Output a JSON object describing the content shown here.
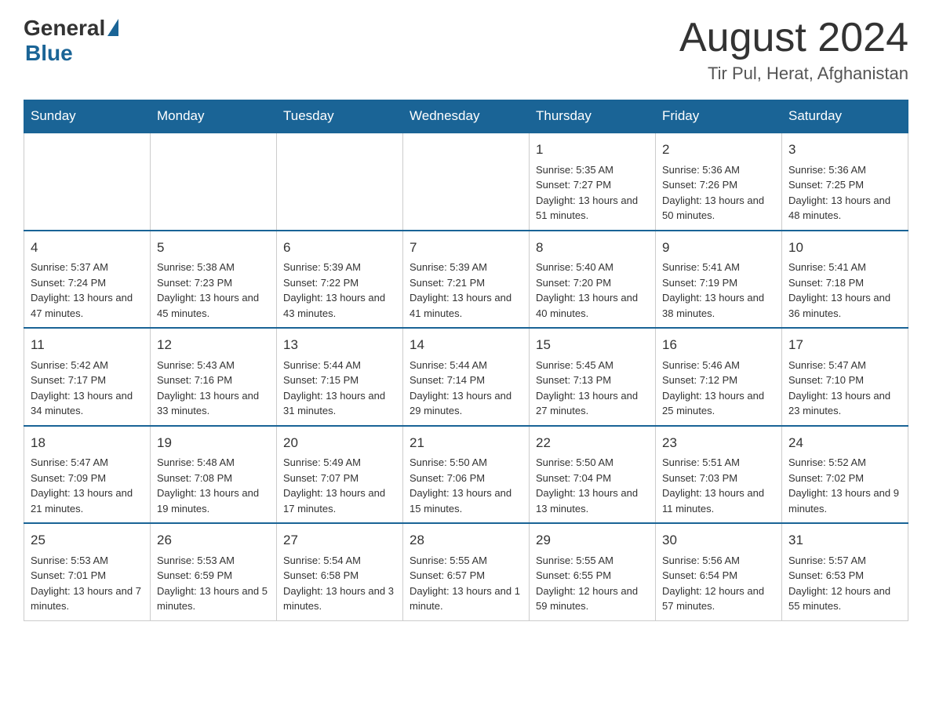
{
  "logo": {
    "general": "General",
    "blue": "Blue"
  },
  "title": {
    "month_year": "August 2024",
    "location": "Tir Pul, Herat, Afghanistan"
  },
  "days_of_week": [
    "Sunday",
    "Monday",
    "Tuesday",
    "Wednesday",
    "Thursday",
    "Friday",
    "Saturday"
  ],
  "weeks": [
    [
      {
        "day": "",
        "info": ""
      },
      {
        "day": "",
        "info": ""
      },
      {
        "day": "",
        "info": ""
      },
      {
        "day": "",
        "info": ""
      },
      {
        "day": "1",
        "info": "Sunrise: 5:35 AM\nSunset: 7:27 PM\nDaylight: 13 hours and 51 minutes."
      },
      {
        "day": "2",
        "info": "Sunrise: 5:36 AM\nSunset: 7:26 PM\nDaylight: 13 hours and 50 minutes."
      },
      {
        "day": "3",
        "info": "Sunrise: 5:36 AM\nSunset: 7:25 PM\nDaylight: 13 hours and 48 minutes."
      }
    ],
    [
      {
        "day": "4",
        "info": "Sunrise: 5:37 AM\nSunset: 7:24 PM\nDaylight: 13 hours and 47 minutes."
      },
      {
        "day": "5",
        "info": "Sunrise: 5:38 AM\nSunset: 7:23 PM\nDaylight: 13 hours and 45 minutes."
      },
      {
        "day": "6",
        "info": "Sunrise: 5:39 AM\nSunset: 7:22 PM\nDaylight: 13 hours and 43 minutes."
      },
      {
        "day": "7",
        "info": "Sunrise: 5:39 AM\nSunset: 7:21 PM\nDaylight: 13 hours and 41 minutes."
      },
      {
        "day": "8",
        "info": "Sunrise: 5:40 AM\nSunset: 7:20 PM\nDaylight: 13 hours and 40 minutes."
      },
      {
        "day": "9",
        "info": "Sunrise: 5:41 AM\nSunset: 7:19 PM\nDaylight: 13 hours and 38 minutes."
      },
      {
        "day": "10",
        "info": "Sunrise: 5:41 AM\nSunset: 7:18 PM\nDaylight: 13 hours and 36 minutes."
      }
    ],
    [
      {
        "day": "11",
        "info": "Sunrise: 5:42 AM\nSunset: 7:17 PM\nDaylight: 13 hours and 34 minutes."
      },
      {
        "day": "12",
        "info": "Sunrise: 5:43 AM\nSunset: 7:16 PM\nDaylight: 13 hours and 33 minutes."
      },
      {
        "day": "13",
        "info": "Sunrise: 5:44 AM\nSunset: 7:15 PM\nDaylight: 13 hours and 31 minutes."
      },
      {
        "day": "14",
        "info": "Sunrise: 5:44 AM\nSunset: 7:14 PM\nDaylight: 13 hours and 29 minutes."
      },
      {
        "day": "15",
        "info": "Sunrise: 5:45 AM\nSunset: 7:13 PM\nDaylight: 13 hours and 27 minutes."
      },
      {
        "day": "16",
        "info": "Sunrise: 5:46 AM\nSunset: 7:12 PM\nDaylight: 13 hours and 25 minutes."
      },
      {
        "day": "17",
        "info": "Sunrise: 5:47 AM\nSunset: 7:10 PM\nDaylight: 13 hours and 23 minutes."
      }
    ],
    [
      {
        "day": "18",
        "info": "Sunrise: 5:47 AM\nSunset: 7:09 PM\nDaylight: 13 hours and 21 minutes."
      },
      {
        "day": "19",
        "info": "Sunrise: 5:48 AM\nSunset: 7:08 PM\nDaylight: 13 hours and 19 minutes."
      },
      {
        "day": "20",
        "info": "Sunrise: 5:49 AM\nSunset: 7:07 PM\nDaylight: 13 hours and 17 minutes."
      },
      {
        "day": "21",
        "info": "Sunrise: 5:50 AM\nSunset: 7:06 PM\nDaylight: 13 hours and 15 minutes."
      },
      {
        "day": "22",
        "info": "Sunrise: 5:50 AM\nSunset: 7:04 PM\nDaylight: 13 hours and 13 minutes."
      },
      {
        "day": "23",
        "info": "Sunrise: 5:51 AM\nSunset: 7:03 PM\nDaylight: 13 hours and 11 minutes."
      },
      {
        "day": "24",
        "info": "Sunrise: 5:52 AM\nSunset: 7:02 PM\nDaylight: 13 hours and 9 minutes."
      }
    ],
    [
      {
        "day": "25",
        "info": "Sunrise: 5:53 AM\nSunset: 7:01 PM\nDaylight: 13 hours and 7 minutes."
      },
      {
        "day": "26",
        "info": "Sunrise: 5:53 AM\nSunset: 6:59 PM\nDaylight: 13 hours and 5 minutes."
      },
      {
        "day": "27",
        "info": "Sunrise: 5:54 AM\nSunset: 6:58 PM\nDaylight: 13 hours and 3 minutes."
      },
      {
        "day": "28",
        "info": "Sunrise: 5:55 AM\nSunset: 6:57 PM\nDaylight: 13 hours and 1 minute."
      },
      {
        "day": "29",
        "info": "Sunrise: 5:55 AM\nSunset: 6:55 PM\nDaylight: 12 hours and 59 minutes."
      },
      {
        "day": "30",
        "info": "Sunrise: 5:56 AM\nSunset: 6:54 PM\nDaylight: 12 hours and 57 minutes."
      },
      {
        "day": "31",
        "info": "Sunrise: 5:57 AM\nSunset: 6:53 PM\nDaylight: 12 hours and 55 minutes."
      }
    ]
  ]
}
